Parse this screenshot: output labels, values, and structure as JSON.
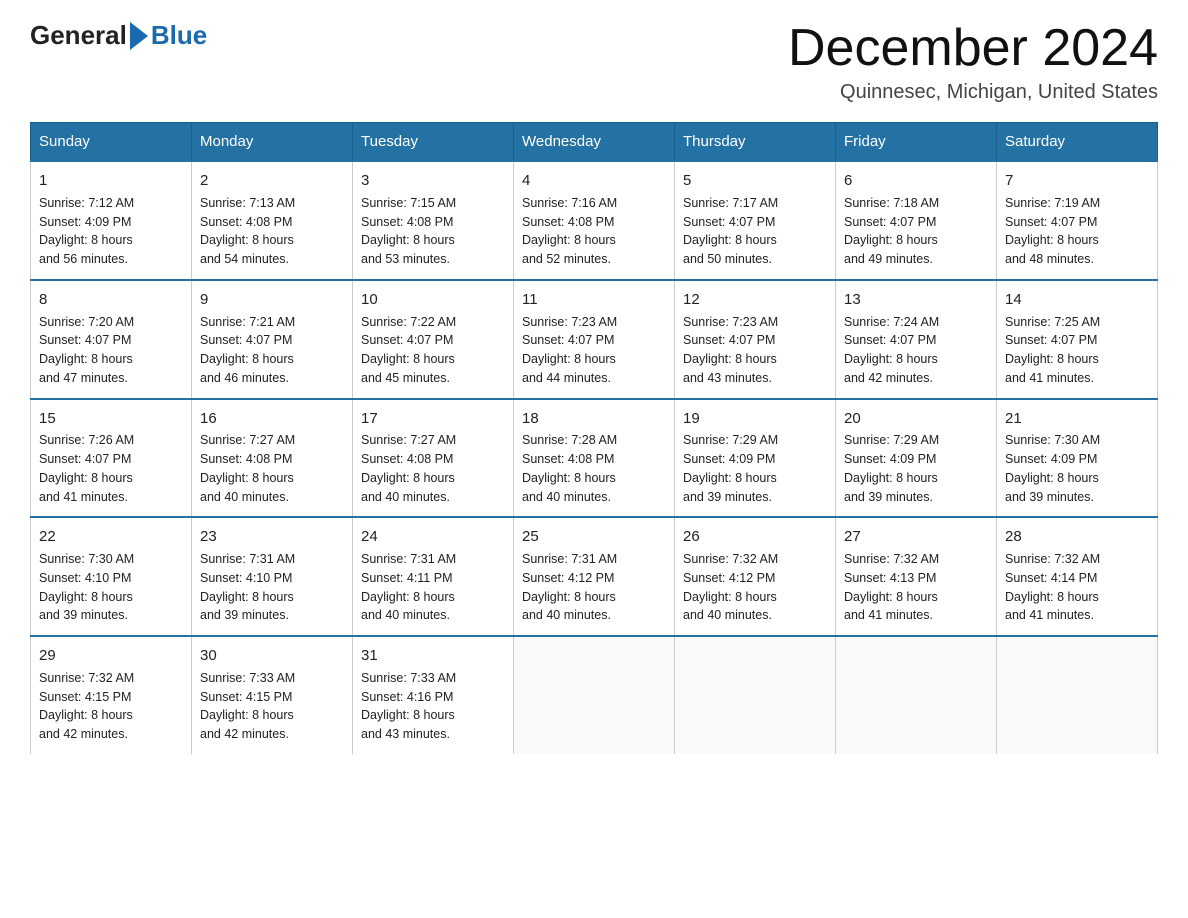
{
  "logo": {
    "general": "General",
    "blue": "Blue"
  },
  "title": "December 2024",
  "location": "Quinnesec, Michigan, United States",
  "days_of_week": [
    "Sunday",
    "Monday",
    "Tuesday",
    "Wednesday",
    "Thursday",
    "Friday",
    "Saturday"
  ],
  "weeks": [
    [
      {
        "day": "1",
        "sunrise": "7:12 AM",
        "sunset": "4:09 PM",
        "daylight": "8 hours and 56 minutes."
      },
      {
        "day": "2",
        "sunrise": "7:13 AM",
        "sunset": "4:08 PM",
        "daylight": "8 hours and 54 minutes."
      },
      {
        "day": "3",
        "sunrise": "7:15 AM",
        "sunset": "4:08 PM",
        "daylight": "8 hours and 53 minutes."
      },
      {
        "day": "4",
        "sunrise": "7:16 AM",
        "sunset": "4:08 PM",
        "daylight": "8 hours and 52 minutes."
      },
      {
        "day": "5",
        "sunrise": "7:17 AM",
        "sunset": "4:07 PM",
        "daylight": "8 hours and 50 minutes."
      },
      {
        "day": "6",
        "sunrise": "7:18 AM",
        "sunset": "4:07 PM",
        "daylight": "8 hours and 49 minutes."
      },
      {
        "day": "7",
        "sunrise": "7:19 AM",
        "sunset": "4:07 PM",
        "daylight": "8 hours and 48 minutes."
      }
    ],
    [
      {
        "day": "8",
        "sunrise": "7:20 AM",
        "sunset": "4:07 PM",
        "daylight": "8 hours and 47 minutes."
      },
      {
        "day": "9",
        "sunrise": "7:21 AM",
        "sunset": "4:07 PM",
        "daylight": "8 hours and 46 minutes."
      },
      {
        "day": "10",
        "sunrise": "7:22 AM",
        "sunset": "4:07 PM",
        "daylight": "8 hours and 45 minutes."
      },
      {
        "day": "11",
        "sunrise": "7:23 AM",
        "sunset": "4:07 PM",
        "daylight": "8 hours and 44 minutes."
      },
      {
        "day": "12",
        "sunrise": "7:23 AM",
        "sunset": "4:07 PM",
        "daylight": "8 hours and 43 minutes."
      },
      {
        "day": "13",
        "sunrise": "7:24 AM",
        "sunset": "4:07 PM",
        "daylight": "8 hours and 42 minutes."
      },
      {
        "day": "14",
        "sunrise": "7:25 AM",
        "sunset": "4:07 PM",
        "daylight": "8 hours and 41 minutes."
      }
    ],
    [
      {
        "day": "15",
        "sunrise": "7:26 AM",
        "sunset": "4:07 PM",
        "daylight": "8 hours and 41 minutes."
      },
      {
        "day": "16",
        "sunrise": "7:27 AM",
        "sunset": "4:08 PM",
        "daylight": "8 hours and 40 minutes."
      },
      {
        "day": "17",
        "sunrise": "7:27 AM",
        "sunset": "4:08 PM",
        "daylight": "8 hours and 40 minutes."
      },
      {
        "day": "18",
        "sunrise": "7:28 AM",
        "sunset": "4:08 PM",
        "daylight": "8 hours and 40 minutes."
      },
      {
        "day": "19",
        "sunrise": "7:29 AM",
        "sunset": "4:09 PM",
        "daylight": "8 hours and 39 minutes."
      },
      {
        "day": "20",
        "sunrise": "7:29 AM",
        "sunset": "4:09 PM",
        "daylight": "8 hours and 39 minutes."
      },
      {
        "day": "21",
        "sunrise": "7:30 AM",
        "sunset": "4:09 PM",
        "daylight": "8 hours and 39 minutes."
      }
    ],
    [
      {
        "day": "22",
        "sunrise": "7:30 AM",
        "sunset": "4:10 PM",
        "daylight": "8 hours and 39 minutes."
      },
      {
        "day": "23",
        "sunrise": "7:31 AM",
        "sunset": "4:10 PM",
        "daylight": "8 hours and 39 minutes."
      },
      {
        "day": "24",
        "sunrise": "7:31 AM",
        "sunset": "4:11 PM",
        "daylight": "8 hours and 40 minutes."
      },
      {
        "day": "25",
        "sunrise": "7:31 AM",
        "sunset": "4:12 PM",
        "daylight": "8 hours and 40 minutes."
      },
      {
        "day": "26",
        "sunrise": "7:32 AM",
        "sunset": "4:12 PM",
        "daylight": "8 hours and 40 minutes."
      },
      {
        "day": "27",
        "sunrise": "7:32 AM",
        "sunset": "4:13 PM",
        "daylight": "8 hours and 41 minutes."
      },
      {
        "day": "28",
        "sunrise": "7:32 AM",
        "sunset": "4:14 PM",
        "daylight": "8 hours and 41 minutes."
      }
    ],
    [
      {
        "day": "29",
        "sunrise": "7:32 AM",
        "sunset": "4:15 PM",
        "daylight": "8 hours and 42 minutes."
      },
      {
        "day": "30",
        "sunrise": "7:33 AM",
        "sunset": "4:15 PM",
        "daylight": "8 hours and 42 minutes."
      },
      {
        "day": "31",
        "sunrise": "7:33 AM",
        "sunset": "4:16 PM",
        "daylight": "8 hours and 43 minutes."
      },
      null,
      null,
      null,
      null
    ]
  ],
  "labels": {
    "sunrise": "Sunrise:",
    "sunset": "Sunset:",
    "daylight": "Daylight:"
  }
}
